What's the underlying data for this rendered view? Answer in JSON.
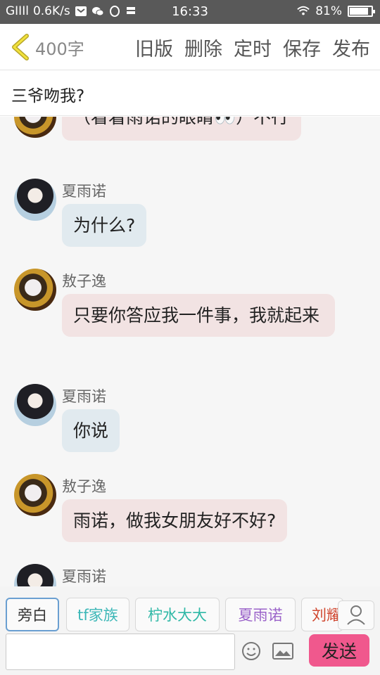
{
  "status_bar": {
    "carrier": "GIIIl",
    "speed": "0.6K/s",
    "time": "16:33",
    "battery": "81%",
    "battery_level": 0.81
  },
  "toolbar": {
    "word_count": "400字",
    "old_version": "旧版",
    "delete": "删除",
    "schedule": "定时",
    "save": "保存",
    "publish": "发布"
  },
  "story_title": "三爷吻我?",
  "messages": [
    {
      "speaker": "",
      "text": "（看着雨诺的眼睛👀）不行",
      "style": "pink"
    },
    {
      "speaker": "夏雨诺",
      "text": "为什么?",
      "style": "blue"
    },
    {
      "speaker": "敖子逸",
      "text": "只要你答应我一件事，我就起来",
      "style": "pink"
    },
    {
      "speaker": "夏雨诺",
      "text": "你说",
      "style": "blue"
    },
    {
      "speaker": "敖子逸",
      "text": "雨诺，做我女朋友好不好?",
      "style": "pink"
    },
    {
      "speaker": "夏雨诺",
      "text": "",
      "style": "blue"
    }
  ],
  "characters": [
    {
      "label": "旁白",
      "color": "#333333"
    },
    {
      "label": "tf家族",
      "color": "#3bb7b7"
    },
    {
      "label": "柠水大大",
      "color": "#2fb8a6"
    },
    {
      "label": "夏雨诺",
      "color": "#9a62c9"
    },
    {
      "label": "刘耀",
      "color": "#d0462e"
    }
  ],
  "input": {
    "placeholder": "",
    "send_label": "发送"
  },
  "colors": {
    "accent": "#f0588d",
    "bubble_pink": "#f2e3e3",
    "bubble_blue": "#e1eaef"
  }
}
